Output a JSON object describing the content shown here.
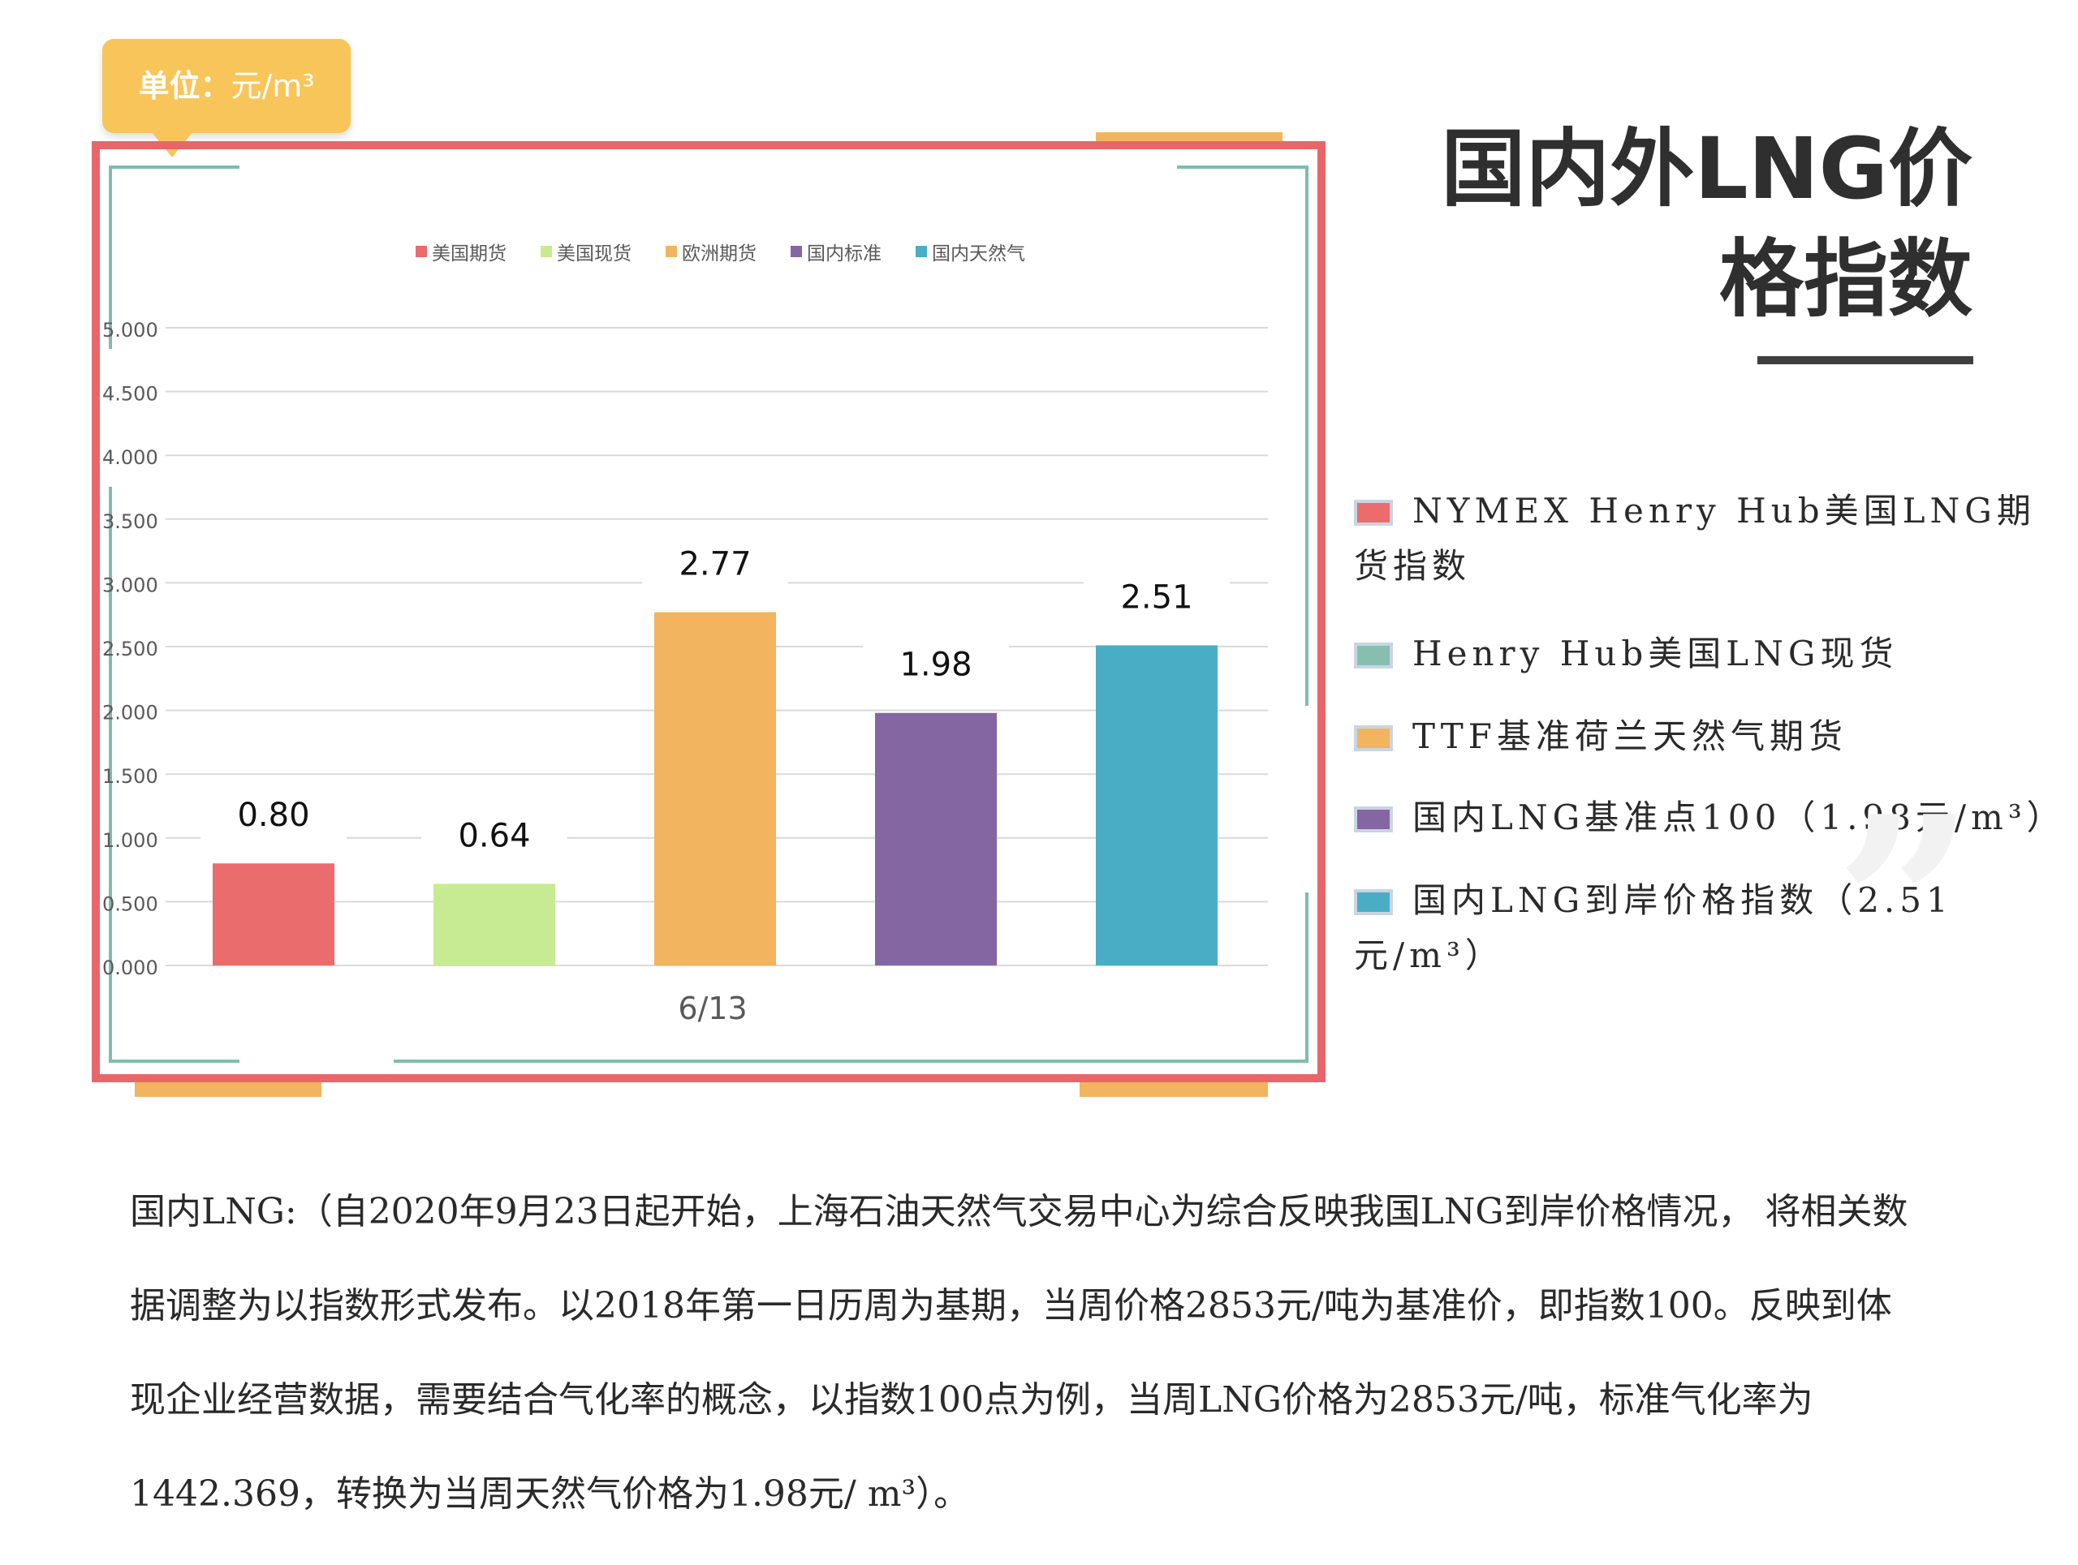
{
  "unit_badge": {
    "label": "单位：",
    "unit": "元/m³"
  },
  "title": {
    "line1": "国内外LNG价",
    "line2": "格指数"
  },
  "chart_data": {
    "type": "bar",
    "x_category": "6/13",
    "legend": [
      "美国期货",
      "美国现货",
      "欧洲期货",
      "国内标准",
      "国内天然气"
    ],
    "legend_position": "top",
    "series": [
      {
        "name": "美国期货",
        "value": 0.8,
        "label": "0.80",
        "color": "#ea6c6c"
      },
      {
        "name": "美国现货",
        "value": 0.64,
        "label": "0.64",
        "color": "#c6eb92"
      },
      {
        "name": "欧洲期货",
        "value": 2.77,
        "label": "2.77",
        "color": "#f2b45e"
      },
      {
        "name": "国内标准",
        "value": 1.98,
        "label": "1.98",
        "color": "#8466a3"
      },
      {
        "name": "国内天然气",
        "value": 2.51,
        "label": "2.51",
        "color": "#4aadc6"
      }
    ],
    "yticks": [
      "0.000",
      "0.500",
      "1.000",
      "1.500",
      "2.000",
      "2.500",
      "3.000",
      "3.500",
      "4.000",
      "4.500",
      "5.000"
    ],
    "ylim": [
      0,
      5
    ],
    "grid": true
  },
  "descriptions": [
    {
      "text": "NYMEX Henry Hub美国LNG期货指数",
      "color": "#ea6c6c"
    },
    {
      "text": "Henry Hub美国LNG现货",
      "color": "#86bfb0"
    },
    {
      "text": "TTF基准荷兰天然气期货",
      "color": "#f2b45e"
    },
    {
      "text": "国内LNG基准点100（1.98元/m³）",
      "color": "#8466a3"
    },
    {
      "text": "国内LNG到岸价格指数（2.51元/m³）",
      "color": "#4aadc6"
    }
  ],
  "body": {
    "p1": "国内LNG:（自2020年9月23日起开始，上海石油天然气交易中心为综合反映我国LNG到岸价格情况， 将相关数",
    "p2": "据调整为以指数形式发布。以2018年第一日历周为基期，当周价格2853元/吨为基准价，即指数100。反映到体",
    "p3": "现企业经营数据，需要结合气化率的概念，以指数100点为例，当周LNG价格为2853元/吨，标准气化率为",
    "p4": "1442.369，转换为当周天然气价格为1.98元/ m³）。"
  }
}
